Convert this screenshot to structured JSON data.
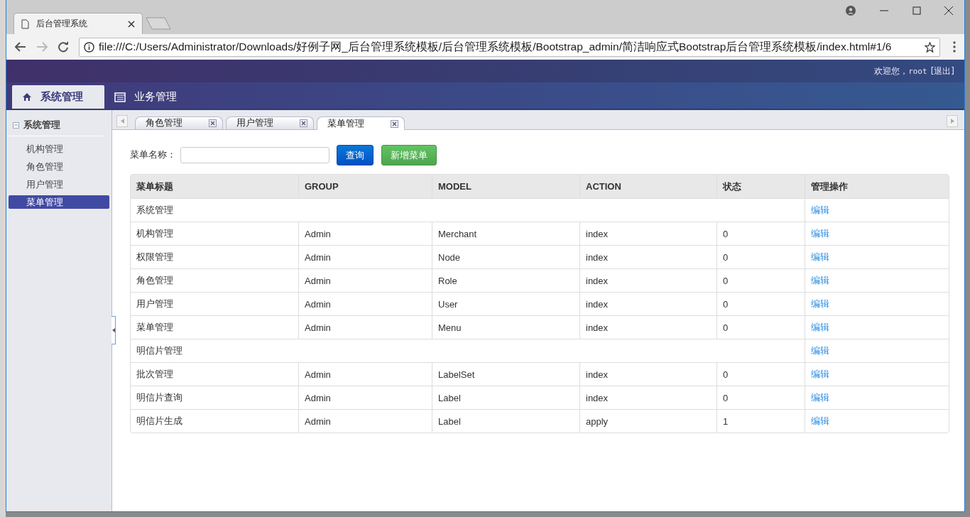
{
  "browser": {
    "tab_title": "后台管理系统",
    "address": "file:///C:/Users/Administrator/Downloads/好例子网_后台管理系统模板/后台管理系统模板/Bootstrap_admin/简洁响应式Bootstrap后台管理系统模板/index.html#1/6"
  },
  "header": {
    "greeting": "欢迎您，",
    "user": "root",
    "logout": "[退出]"
  },
  "nav_tabs": [
    {
      "label": "系统管理",
      "selected": true,
      "kind": "home"
    },
    {
      "label": "业务管理",
      "selected": false,
      "kind": "list"
    }
  ],
  "sidebar": {
    "group": {
      "label": "系统管理",
      "expanded": true
    },
    "items": [
      {
        "label": "机构管理",
        "selected": false
      },
      {
        "label": "角色管理",
        "selected": false
      },
      {
        "label": "用户管理",
        "selected": false
      },
      {
        "label": "菜单管理",
        "selected": true
      }
    ]
  },
  "page_tabs": [
    {
      "label": "角色管理",
      "selected": false
    },
    {
      "label": "用户管理",
      "selected": false
    },
    {
      "label": "菜单管理",
      "selected": true
    }
  ],
  "search": {
    "label": "菜单名称："
  },
  "buttons": [
    {
      "label": "查询",
      "kind": "primary"
    },
    {
      "label": "新增菜单",
      "kind": "success"
    }
  ],
  "table": {
    "columns": [
      "菜单标题",
      "GROUP",
      "MODEL",
      "ACTION",
      "状态",
      "管理操作"
    ],
    "rows": [
      {
        "kind": "group",
        "title": "系统管理",
        "action_link": "编辑"
      },
      {
        "kind": "item",
        "title": "机构管理",
        "group": "Admin",
        "model": "Merchant",
        "action": "index",
        "status": "0",
        "action_link": "编辑"
      },
      {
        "kind": "item",
        "title": "权限管理",
        "group": "Admin",
        "model": "Node",
        "action": "index",
        "status": "0",
        "action_link": "编辑"
      },
      {
        "kind": "item",
        "title": "角色管理",
        "group": "Admin",
        "model": "Role",
        "action": "index",
        "status": "0",
        "action_link": "编辑"
      },
      {
        "kind": "item",
        "title": "用户管理",
        "group": "Admin",
        "model": "User",
        "action": "index",
        "status": "0",
        "action_link": "编辑"
      },
      {
        "kind": "item",
        "title": "菜单管理",
        "group": "Admin",
        "model": "Menu",
        "action": "index",
        "status": "0",
        "action_link": "编辑"
      },
      {
        "kind": "group",
        "title": "明信片管理",
        "action_link": "编辑"
      },
      {
        "kind": "item",
        "title": "批次管理",
        "group": "Admin",
        "model": "LabelSet",
        "action": "index",
        "status": "0",
        "action_link": "编辑"
      },
      {
        "kind": "item",
        "title": "明信片查询",
        "group": "Admin",
        "model": "Label",
        "action": "index",
        "status": "0",
        "action_link": "编辑"
      },
      {
        "kind": "item",
        "title": "明信片生成",
        "group": "Admin",
        "model": "Label",
        "action": "apply",
        "status": "1",
        "action_link": "编辑"
      }
    ]
  }
}
